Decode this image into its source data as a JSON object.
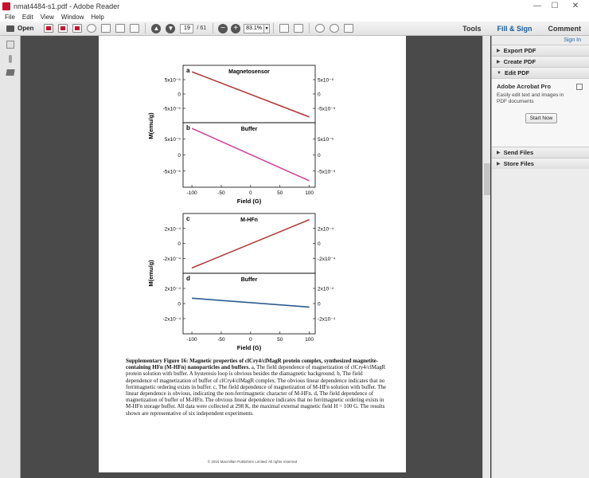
{
  "window": {
    "title": "nmat4484-s1.pdf - Adobe Reader"
  },
  "menu": [
    "File",
    "Edit",
    "View",
    "Window",
    "Help"
  ],
  "toolbar": {
    "open_label": "Open",
    "page_current": "19",
    "page_total": "/ 61",
    "zoom": "83.1%",
    "tabs": [
      "Tools",
      "Fill & Sign",
      "Comment"
    ]
  },
  "right_panel": {
    "sign_in": "Sign In",
    "sections": [
      "Export PDF",
      "Create PDF",
      "Edit PDF",
      "Send Files",
      "Store Files"
    ],
    "edit_pdf": {
      "product": "Adobe Acrobat Pro",
      "description": "Easily edit text and images in PDF documents",
      "button": "Start Now"
    }
  },
  "chart_data": [
    {
      "type": "line",
      "panel": "a",
      "title": "Magnetosensor",
      "x": [
        -100,
        100
      ],
      "series": [
        {
          "values": [
            6.2e-05,
            -6.4e-05
          ],
          "color": "#b03a3a"
        }
      ],
      "xlim": [
        -115,
        110
      ],
      "ylim": [
        -8e-05,
        8e-05
      ],
      "yticks": [
        "5x10⁻⁵",
        "0",
        "-5x10⁻⁵"
      ]
    },
    {
      "type": "line",
      "panel": "b",
      "title": "Buffer",
      "x": [
        -100,
        100
      ],
      "series": [
        {
          "values": [
            6.6e-05,
            -6.4e-05
          ],
          "color": "#d24a9a"
        }
      ],
      "xlim": [
        -115,
        110
      ],
      "ylim": [
        -8e-05,
        8e-05
      ],
      "yticks": [
        "5x10⁻⁵",
        "0",
        "-5x10⁻⁵"
      ],
      "xticks": [
        "-100",
        "-50",
        "0",
        "50",
        "100"
      ],
      "xlabel": "Field (G)"
    },
    {
      "type": "line",
      "panel": "c",
      "title": "M-HFn",
      "x": [
        -100,
        100
      ],
      "series": [
        {
          "values": [
            -0.00028,
            0.00027
          ],
          "color": "#b03a3a"
        }
      ],
      "xlim": [
        -115,
        110
      ],
      "ylim": [
        -0.00034,
        0.00034
      ],
      "yticks": [
        "2x10⁻⁴",
        "0",
        "-2x10⁻⁴"
      ]
    },
    {
      "type": "line",
      "panel": "d",
      "title": "Buffer",
      "x": [
        -100,
        100
      ],
      "series": [
        {
          "values": [
            6e-05,
            -4e-05
          ],
          "color": "#2a5b8c"
        }
      ],
      "xlim": [
        -115,
        110
      ],
      "ylim": [
        -0.00034,
        0.00034
      ],
      "yticks": [
        "2x10⁻⁴",
        "0",
        "-2x10⁻⁴"
      ],
      "xticks": [
        "-100",
        "-50",
        "0",
        "50",
        "100"
      ],
      "xlabel": "Field (G)"
    }
  ],
  "ylabel": "M(emu/g)",
  "caption": {
    "bold": "Supplementary Figure 16: Magnetic properties of clCry4/clMagR protein complex, synthesized magnetite-containing HFn (M-HFn) nanoparticles and buffers.",
    "text": " a, The field dependence of magnetization of clCry4/clMagR protein solution with buffer. A hysteresis loop is obvious besides the diamagnetic background. b, The field dependence of magnetization of buffer of clCry4/clMagR complex. The obvious linear dependence indicates that no ferrimagnetic ordering exists in buffer. c, The field dependence of magnetization of M-HFn solution with buffer. The linear dependence is obvious, indicating the non-ferrimagnetic character of M-HFn. d, The field dependence of magnetization of buffer of M-HFn. The obvious linear dependence indicates that no ferrimagnetic ordering exists in M-HFn storage buffer. All data were collected at 298 K, the maximal external magnetic field H = 100 G. The results shown are representative of six independent experiments."
  },
  "footer": "© 2016 Macmillan Publishers Limited. All rights reserved"
}
